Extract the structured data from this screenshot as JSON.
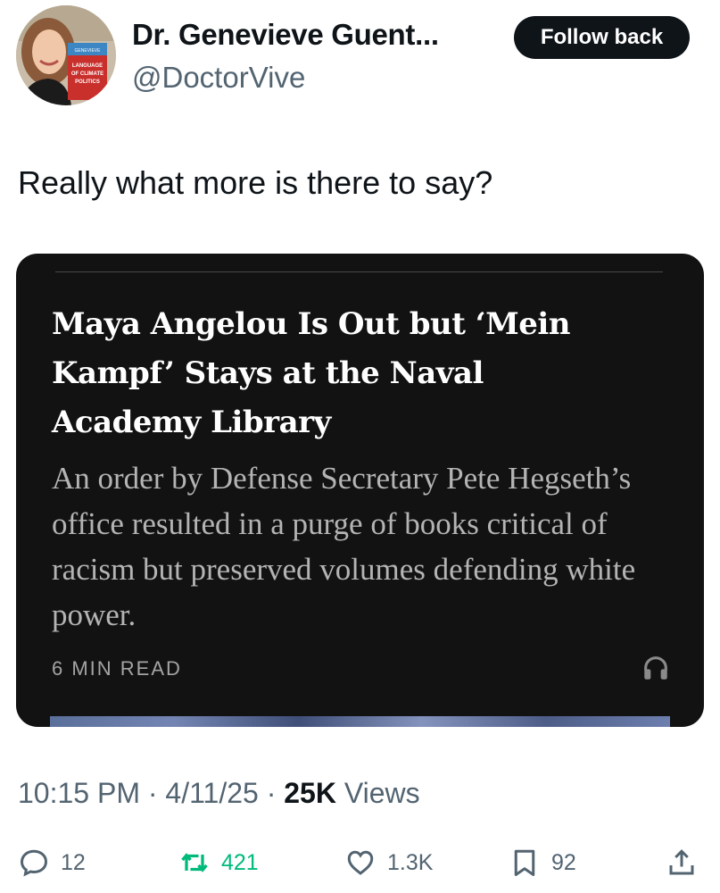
{
  "author": {
    "name": "Dr. Genevieve Guent...",
    "handle": "@DoctorVive",
    "follow_label": "Follow back",
    "avatar_book_text": [
      "GENEVIEVE",
      "GUENTHER",
      "THE",
      "LANGUAGE",
      "OF CLIMATE",
      "POLITICS"
    ]
  },
  "tweet": {
    "text": "Really what more is there to say?"
  },
  "card": {
    "headline": "Maya Angelou Is Out but ‘Mein Kampf’ Stays at the Naval Academy Library",
    "summary": "An order by Defense Secretary Pete Hegseth’s office resulted in a purge of books critical of racism but preserved volumes defending white power.",
    "read_time": "6 MIN READ",
    "icon": "headphones-icon"
  },
  "meta": {
    "time": "10:15 PM",
    "date": "4/11/25",
    "views_count": "25K",
    "views_label": "Views",
    "separator": "·"
  },
  "actions": {
    "replies": "12",
    "retweets": "421",
    "likes": "1.3K",
    "bookmarks": "92"
  },
  "colors": {
    "retweet_green": "#00ba7c",
    "muted": "#536471",
    "card_bg": "#121212"
  }
}
